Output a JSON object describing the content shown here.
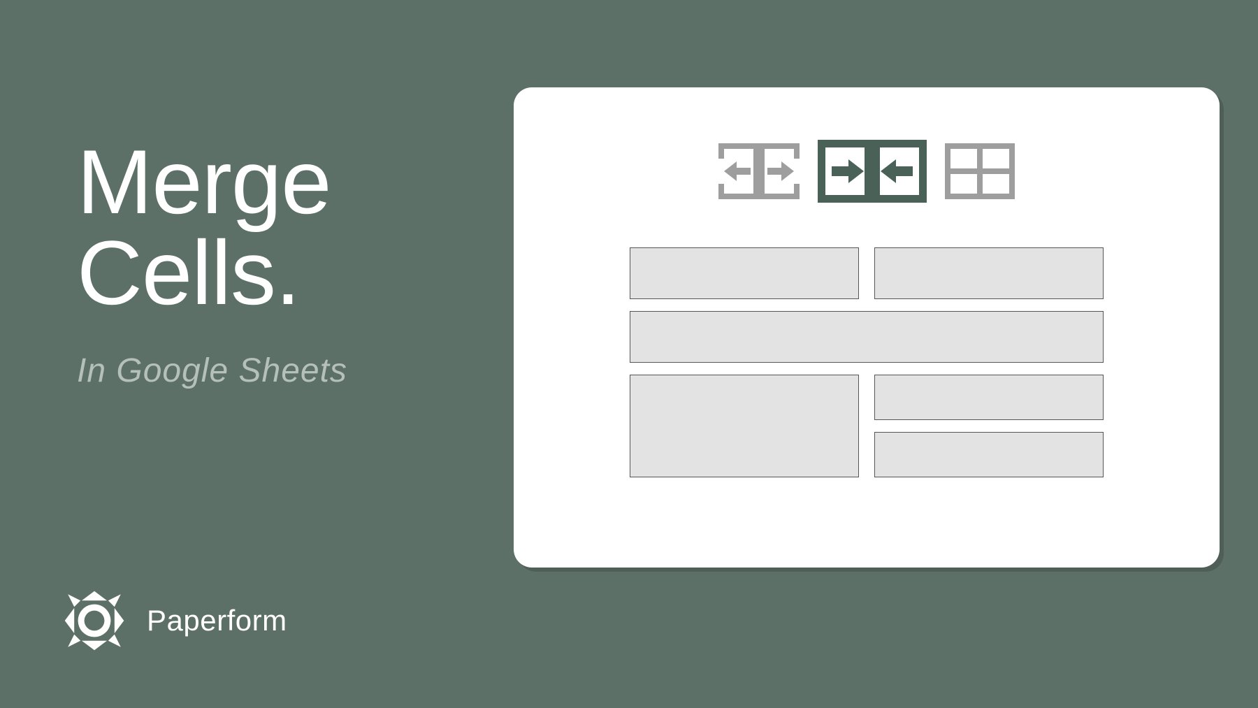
{
  "title_line1": "Merge",
  "title_line2": "Cells.",
  "subtitle": "In Google Sheets",
  "brand": {
    "name": "Paperform"
  },
  "colors": {
    "background": "#5d7068",
    "panel": "#ffffff",
    "cell_fill": "#e3e3e3",
    "icon_inactive": "#9e9e9e",
    "icon_active": "#4a6158"
  },
  "toolbar_icons": [
    {
      "name": "unmerge-cells-icon",
      "active": false
    },
    {
      "name": "merge-horizontally-icon",
      "active": true
    },
    {
      "name": "grid-cells-icon",
      "active": false
    }
  ],
  "cells_layout": [
    {
      "row": 1,
      "span_cols": 1,
      "span_rows": 1
    },
    {
      "row": 1,
      "span_cols": 1,
      "span_rows": 1
    },
    {
      "row": 2,
      "span_cols": 2,
      "span_rows": 1
    },
    {
      "row": 3,
      "span_cols": 1,
      "span_rows": 2
    },
    {
      "row": 3,
      "span_cols": 1,
      "span_rows": 1
    },
    {
      "row": 4,
      "span_cols": 1,
      "span_rows": 1
    }
  ]
}
